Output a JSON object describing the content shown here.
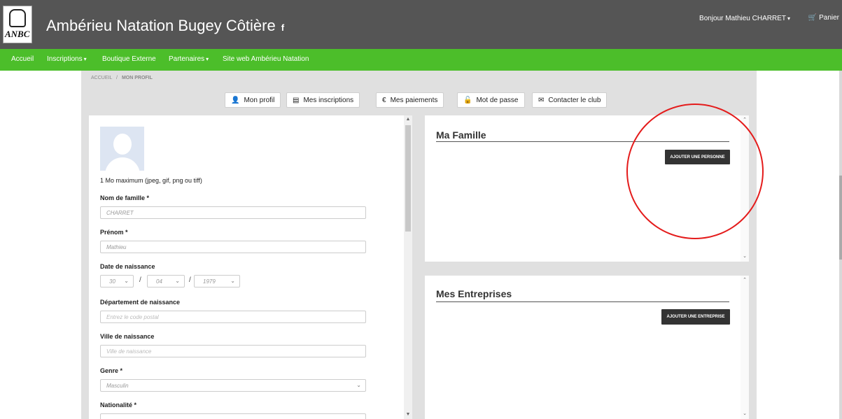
{
  "header": {
    "logo_text": "ANBC",
    "title": "Ambérieu Natation Bugey Côtière",
    "facebook_icon": "f",
    "user_greeting": "Bonjour Mathieu CHARRET",
    "cart_label": "Panier"
  },
  "nav": {
    "items": [
      {
        "label": "Accueil"
      },
      {
        "label": "Inscriptions"
      },
      {
        "label": "Boutique Externe"
      },
      {
        "label": "Partenaires"
      },
      {
        "label": "Site web Ambérieu Natation"
      }
    ]
  },
  "breadcrumb": {
    "home": "ACCUEIL",
    "separator": "/",
    "current": "MON PROFIL"
  },
  "tabs": [
    {
      "label": "Mon profil",
      "icon": "user-icon"
    },
    {
      "label": "Mes inscriptions",
      "icon": "list-icon"
    },
    {
      "label": "Mes paiements",
      "icon": "euro-icon"
    },
    {
      "label": "Mot de passe",
      "icon": "unlock-icon"
    },
    {
      "label": "Contacter le club",
      "icon": "envelope-icon"
    }
  ],
  "profile": {
    "photo_hint": "1 Mo maximum (jpeg, gif, png ou tiff)",
    "last_name": {
      "label": "Nom de famille *",
      "value": "CHARRET"
    },
    "first_name": {
      "label": "Prénom *",
      "value": "Mathieu"
    },
    "birth_date": {
      "label": "Date de naissance",
      "day": "30",
      "month": "04",
      "year": "1979",
      "separator": "/"
    },
    "birth_department": {
      "label": "Département de naissance",
      "placeholder": "Entrez le code postal"
    },
    "birth_city": {
      "label": "Ville de naissance",
      "placeholder": "Ville de naissance"
    },
    "gender": {
      "label": "Genre *",
      "value": "Masculin"
    },
    "nationality": {
      "label": "Nationalité *"
    }
  },
  "family": {
    "title": "Ma Famille",
    "add_button": "AJOUTER UNE PERSONNE"
  },
  "companies": {
    "title": "Mes Entreprises",
    "add_button": "AJOUTER UNE ENTREPRISE"
  },
  "colors": {
    "header_bg": "#555555",
    "nav_bg": "#4cbe2a",
    "annotation_circle": "#e41b1b"
  }
}
